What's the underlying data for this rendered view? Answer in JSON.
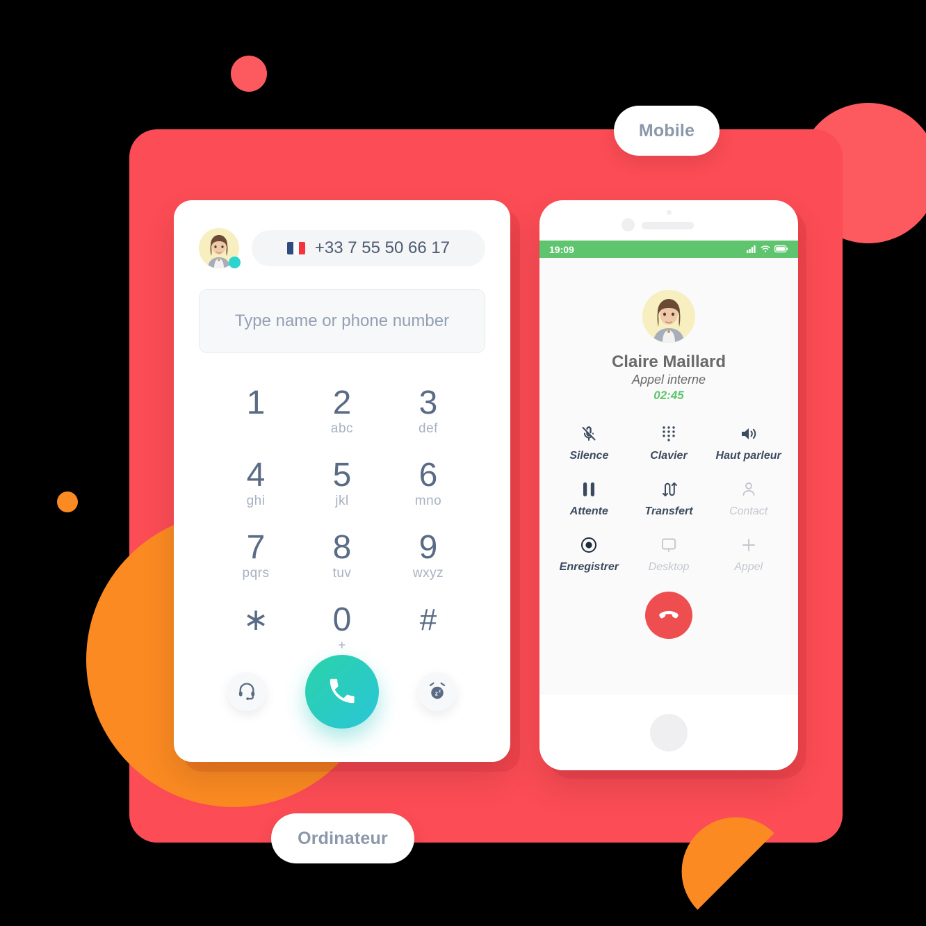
{
  "labels": {
    "mobile": "Mobile",
    "ordinateur": "Ordinateur"
  },
  "dialer": {
    "phone_number": "+33 7 55 50 66 17",
    "flag": "france-flag",
    "search_placeholder": "Type name or phone number",
    "search_value": "",
    "keys": [
      {
        "num": "1",
        "sub": ""
      },
      {
        "num": "2",
        "sub": "abc"
      },
      {
        "num": "3",
        "sub": "def"
      },
      {
        "num": "4",
        "sub": "ghi"
      },
      {
        "num": "5",
        "sub": "jkl"
      },
      {
        "num": "6",
        "sub": "mno"
      },
      {
        "num": "7",
        "sub": "pqrs"
      },
      {
        "num": "8",
        "sub": "tuv"
      },
      {
        "num": "9",
        "sub": "wxyz"
      },
      {
        "num": "∗",
        "sub": ""
      },
      {
        "num": "0",
        "sub": "+"
      },
      {
        "num": "#",
        "sub": ""
      }
    ],
    "actions": {
      "headset": "headset-icon",
      "call": "phone-call-icon",
      "snooze": "alarm-snooze-icon"
    },
    "colors": {
      "call_button_start": "#29D3A8",
      "call_button_end": "#2BC5D8",
      "key_number": "#5A6B85",
      "key_letters": "#A7B1C1"
    }
  },
  "phone": {
    "status_bar": {
      "time": "19:09",
      "icons": [
        "signal-icon",
        "wifi-icon",
        "battery-icon"
      ],
      "background": "#5EC56E"
    },
    "call": {
      "contact_name": "Claire Maillard",
      "call_type": "Appel interne",
      "duration": "02:45",
      "duration_color": "#5EC56E"
    },
    "controls": [
      {
        "label": "Silence",
        "icon": "microphone-muted-icon",
        "state": "active"
      },
      {
        "label": "Clavier",
        "icon": "keypad-dots-icon",
        "state": "active"
      },
      {
        "label": "Haut parleur",
        "icon": "speaker-icon",
        "state": "active"
      },
      {
        "label": "Attente",
        "icon": "pause-icon",
        "state": "active"
      },
      {
        "label": "Transfert",
        "icon": "transfer-arrows-icon",
        "state": "active"
      },
      {
        "label": "Contact",
        "icon": "person-icon",
        "state": "disabled"
      },
      {
        "label": "Enregistrer",
        "icon": "record-icon",
        "state": "active"
      },
      {
        "label": "Desktop",
        "icon": "monitor-icon",
        "state": "disabled"
      },
      {
        "label": "Appel",
        "icon": "plus-icon",
        "state": "disabled"
      }
    ],
    "hangup": {
      "icon": "hangup-icon",
      "color": "#EE4E50"
    }
  },
  "theme": {
    "panel_red": "#FC4C55",
    "accent_orange": "#FB8A22",
    "pill_text": "#8B97AB"
  }
}
